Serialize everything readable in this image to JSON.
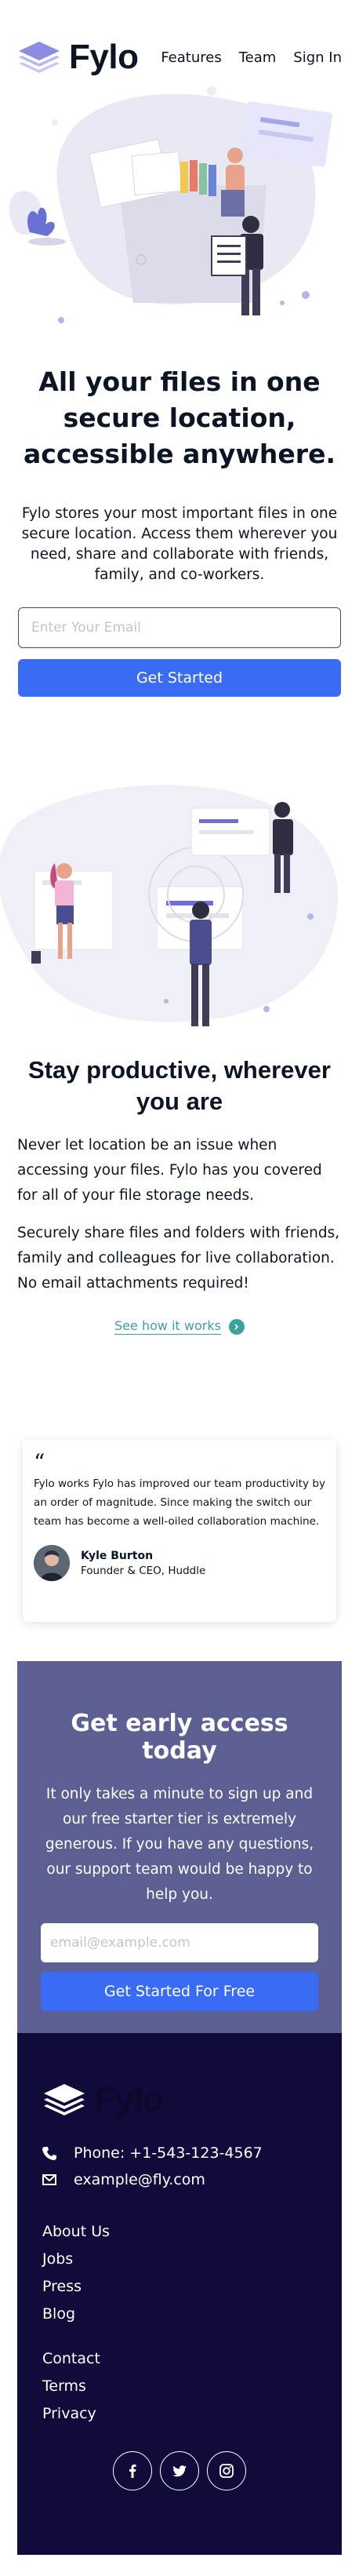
{
  "header": {
    "logo_text": "Fylo",
    "nav": [
      "Features",
      "Team",
      "Sign In"
    ]
  },
  "hero": {
    "title": "All your files in one secure location, accessible anywhere.",
    "description": "Fylo stores your most important files in one secure location. Access them wherever you need, share and collaborate with friends, family, and co-workers.",
    "email_placeholder": "Enter Your Email",
    "cta_label": "Get Started"
  },
  "productive": {
    "title": "Stay productive, wherever you are",
    "paragraph_1": "Never let location be an issue when accessing your files. Fylo has you covered for all of your file storage needs.",
    "paragraph_2": "Securely share files and folders with friends, family and colleagues for live collaboration. No email attachments required!",
    "link_label": "See how it works"
  },
  "testimonial": {
    "quote": "Fylo works Fylo has improved our team productivity by an order of magnitude. Since making the switch our team has become a well-oiled collaboration machine.",
    "author_name": "Kyle Burton",
    "author_role": "Founder & CEO, Huddle"
  },
  "early_access": {
    "title": "Get early access today",
    "description": "It only takes a minute to sign up and our free starter tier is extremely generous. If you have any questions, our support team would be happy to help you.",
    "email_placeholder": "email@example.com",
    "button_label": "Get Started For Free"
  },
  "footer": {
    "logo_text": "Fylo",
    "phone": "Phone: +1-543-123-4567",
    "email": "example@fly.com",
    "links_primary": [
      "About Us",
      "Jobs",
      "Press",
      "Blog"
    ],
    "links_secondary": [
      "Contact",
      "Terms",
      "Privacy"
    ],
    "socials": [
      "facebook-icon",
      "twitter-icon",
      "instagram-icon"
    ]
  },
  "colors": {
    "primary_blue": "#3a6bf5",
    "teal": "#3ba29b",
    "early_access_bg": "#5c5f91",
    "footer_bg": "#0f0b3b",
    "text_dark": "#0c1524"
  }
}
